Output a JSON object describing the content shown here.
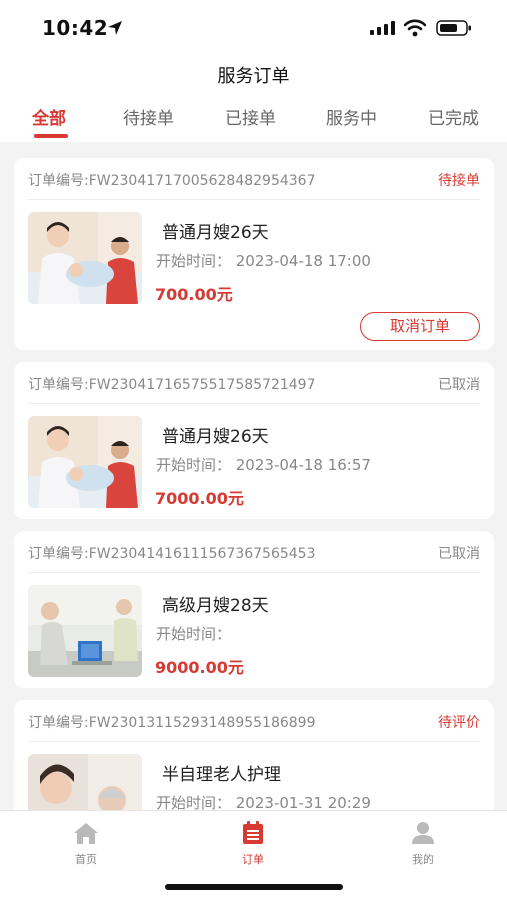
{
  "status_bar": {
    "time": "10:42"
  },
  "header": {
    "title": "服务订单"
  },
  "tabs": [
    {
      "label": "全部",
      "active": true
    },
    {
      "label": "待接单",
      "active": false
    },
    {
      "label": "已接单",
      "active": false
    },
    {
      "label": "服务中",
      "active": false
    },
    {
      "label": "已完成",
      "active": false
    }
  ],
  "orders": [
    {
      "order_no": "订单编号:FW2304171700562848295436​7",
      "status": "待接单",
      "status_color": "#d63a32",
      "service_name": "普通月嫂26天",
      "start_time": "开始时间：  2023-04-18 17:00",
      "price": "700.00元",
      "action_label": "取消订单",
      "image": "nanny-with-baby"
    },
    {
      "order_no": "订单编号:FW2304171657551758572149​7",
      "status": "已取消",
      "status_color": "#888888",
      "service_name": "普通月嫂26天",
      "start_time": "开始时间：  2023-04-18 16:57",
      "price": "7000.00元",
      "image": "nanny-with-baby"
    },
    {
      "order_no": "订单编号:FW2304141611156736756545​3",
      "status": "已取消",
      "status_color": "#888888",
      "service_name": "高级月嫂28天",
      "start_time": "开始时间：",
      "price": "9000.00元",
      "image": "elderly-care-room"
    },
    {
      "order_no": "订单编号:FW2301311529314895518689​9",
      "status": "待评价",
      "status_color": "#d63a32",
      "service_name": "半自理老人护理",
      "start_time": "开始时间：  2023-01-31 20:29",
      "image": "caregiver-with-elder"
    }
  ],
  "bottom_nav": [
    {
      "label": "首页",
      "icon": "home-icon",
      "active": false
    },
    {
      "label": "订单",
      "icon": "order-list-icon",
      "active": true
    },
    {
      "label": "我的",
      "icon": "profile-icon",
      "active": false
    }
  ],
  "colors": {
    "accent": "#d63a32",
    "muted": "#888888",
    "background": "#f3f3f3"
  }
}
